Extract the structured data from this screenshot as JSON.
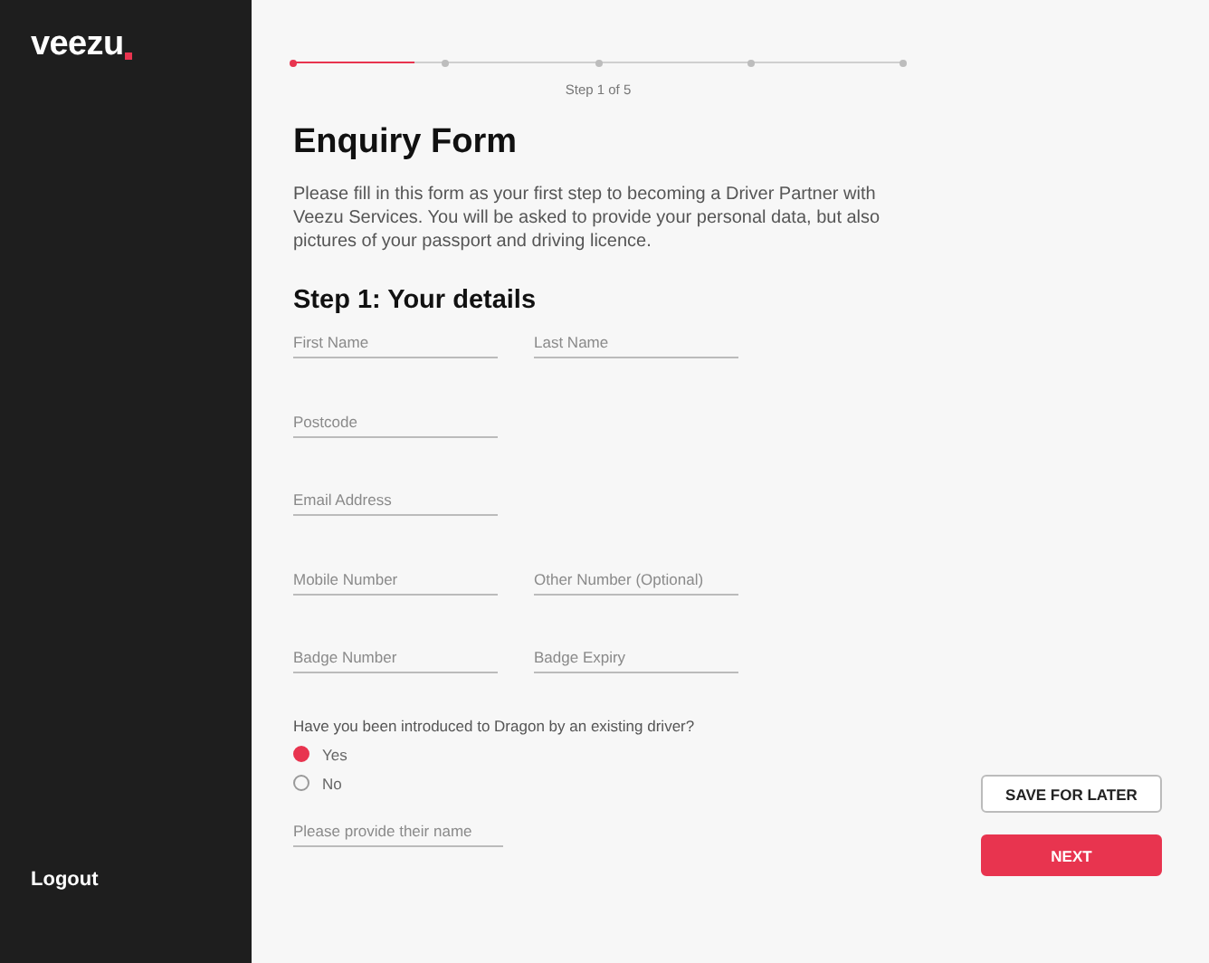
{
  "sidebar": {
    "logo": "veezu",
    "logout": "Logout"
  },
  "progress": {
    "level": 0.2,
    "steps": [
      {
        "selected": true
      },
      {
        "selected": false
      },
      {
        "selected": false
      },
      {
        "selected": false
      },
      {
        "selected": false
      }
    ],
    "caption": "Step 1 of 5"
  },
  "title": "Enquiry Form",
  "intro": "Please fill in this form as your first step to becoming a Driver Partner with Veezu Services. You will be asked to provide your personal data, but also pictures of your passport and driving licence.",
  "section_title": "Step 1: Your details",
  "field_rows": [
    {
      "fields": [
        {
          "placeholder": "First Name"
        },
        {
          "placeholder": "Last Name"
        }
      ]
    },
    {
      "fields": [
        {
          "placeholder": "Postcode"
        }
      ]
    },
    {
      "fields": [
        {
          "placeholder": "Email Address"
        }
      ]
    },
    {
      "fields": [
        {
          "placeholder": "Mobile Number"
        },
        {
          "placeholder": "Other Number (Optional)"
        }
      ]
    },
    {
      "fields": [
        {
          "placeholder": "Badge Number"
        },
        {
          "placeholder": "Badge Expiry"
        }
      ]
    }
  ],
  "question": "Have you been introduced to Dragon by an existing driver?",
  "options": [
    {
      "label": "Yes",
      "selected": true
    },
    {
      "label": "No",
      "selected": false
    }
  ],
  "referrer_field": {
    "placeholder": "Please provide their name"
  },
  "buttons": [
    {
      "kind": "secondary",
      "label": "SAVE FOR LATER"
    },
    {
      "kind": "primary",
      "label": "NEXT"
    }
  ]
}
